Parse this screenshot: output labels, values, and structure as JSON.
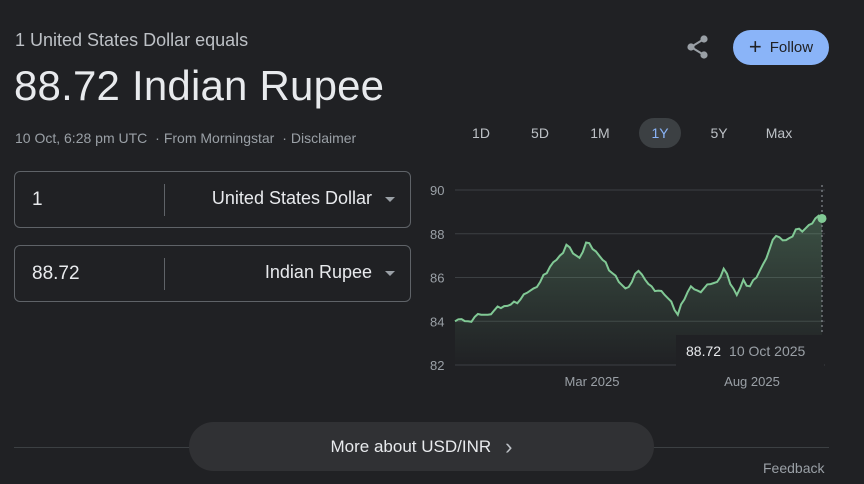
{
  "header": {
    "subtitle": "1 United States Dollar equals",
    "main_value": "88.72 Indian Rupee",
    "timestamp": "10 Oct, 6:28 pm UTC",
    "sep1": "·",
    "source": "From Morningstar",
    "sep2": "·",
    "disclaimer": "Disclaimer"
  },
  "actions": {
    "share_icon": "share-icon",
    "follow_label": "Follow",
    "follow_icon": "+"
  },
  "converter": {
    "from": {
      "amount": "1",
      "currency": "United States Dollar"
    },
    "to": {
      "amount": "88.72",
      "currency": "Indian Rupee"
    }
  },
  "range_tabs": [
    {
      "label": "1D",
      "active": false
    },
    {
      "label": "5D",
      "active": false
    },
    {
      "label": "1M",
      "active": false
    },
    {
      "label": "1Y",
      "active": true
    },
    {
      "label": "5Y",
      "active": false
    },
    {
      "label": "Max",
      "active": false
    }
  ],
  "tooltip": {
    "value": "88.72",
    "date": "10 Oct 2025"
  },
  "colors": {
    "line": "#81c995",
    "accent": "#8ab4f8",
    "background": "#202124"
  },
  "chart_data": {
    "type": "area",
    "title": "",
    "xlabel": "",
    "ylabel": "",
    "ylim": [
      82,
      90
    ],
    "yticks": [
      90,
      88,
      86,
      84,
      82
    ],
    "xticks": [
      "Mar 2025",
      "Aug 2025"
    ],
    "grid": true,
    "series": [
      {
        "values": [
          84.0,
          84.1,
          84.0,
          84.2,
          84.3,
          84.3,
          84.5,
          84.6,
          84.7,
          84.9,
          85.0,
          85.3,
          85.5,
          85.8,
          86.2,
          86.7,
          87.0,
          87.5,
          87.1,
          86.9,
          87.6,
          87.3,
          87.0,
          86.7,
          86.2,
          85.8,
          85.5,
          85.8,
          86.3,
          85.9,
          85.6,
          85.4,
          85.2,
          84.9,
          84.3,
          85.0,
          85.6,
          85.4,
          85.5,
          85.7,
          85.8,
          86.4,
          85.7,
          85.2,
          85.9,
          85.6,
          86.0,
          86.6,
          87.3,
          87.9,
          87.7,
          87.8,
          88.2,
          88.1,
          88.4,
          88.7,
          88.7
        ]
      }
    ],
    "last_value": 88.72
  },
  "more_button": {
    "label": "More about USD/INR",
    "icon": "›"
  },
  "feedback_label": "Feedback"
}
